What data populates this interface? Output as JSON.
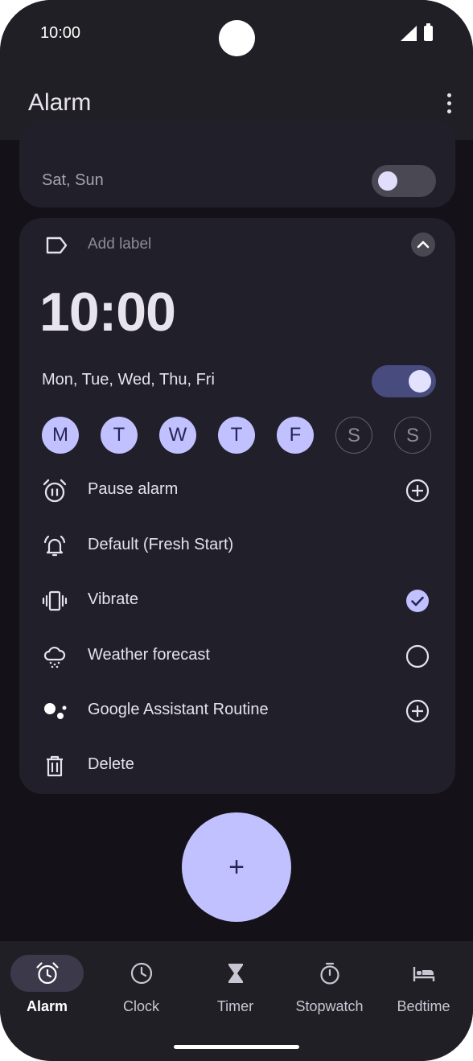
{
  "status_bar": {
    "time": "10:00"
  },
  "app_bar": {
    "title": "Alarm"
  },
  "alarm_card_1": {
    "days_text": "Sat, Sun",
    "enabled": false
  },
  "alarm_card_2": {
    "label_placeholder": "Add label",
    "time": "10:00",
    "days_text": "Mon, Tue, Wed, Thu, Fri",
    "enabled": true,
    "day_buttons": [
      {
        "letter": "M",
        "selected": true
      },
      {
        "letter": "T",
        "selected": true
      },
      {
        "letter": "W",
        "selected": true
      },
      {
        "letter": "T",
        "selected": true
      },
      {
        "letter": "F",
        "selected": true
      },
      {
        "letter": "S",
        "selected": false
      },
      {
        "letter": "S",
        "selected": false
      }
    ],
    "options": [
      {
        "label": "Pause alarm",
        "icon": "pause-alarm-icon",
        "action": "add"
      },
      {
        "label": "Default (Fresh Start)",
        "icon": "bell-icon",
        "action": "none"
      },
      {
        "label": "Vibrate",
        "icon": "vibrate-icon",
        "action": "checked"
      },
      {
        "label": "Weather forecast",
        "icon": "weather-icon",
        "action": "unchecked"
      },
      {
        "label": "Google Assistant Routine",
        "icon": "assistant-icon",
        "action": "add"
      },
      {
        "label": "Delete",
        "icon": "trash-icon",
        "action": "none"
      }
    ]
  },
  "fab": {
    "symbol": "+"
  },
  "bottom_nav": {
    "items": [
      {
        "label": "Alarm",
        "icon": "alarm-icon",
        "active": true
      },
      {
        "label": "Clock",
        "icon": "clock-icon",
        "active": false
      },
      {
        "label": "Timer",
        "icon": "hourglass-icon",
        "active": false
      },
      {
        "label": "Stopwatch",
        "icon": "stopwatch-icon",
        "active": false
      },
      {
        "label": "Bedtime",
        "icon": "bed-icon",
        "active": false
      }
    ]
  },
  "colors": {
    "accent": "#c2c1ff",
    "background": "#141218",
    "surface": "#211f2a",
    "toggle_on": "#474b7e"
  }
}
